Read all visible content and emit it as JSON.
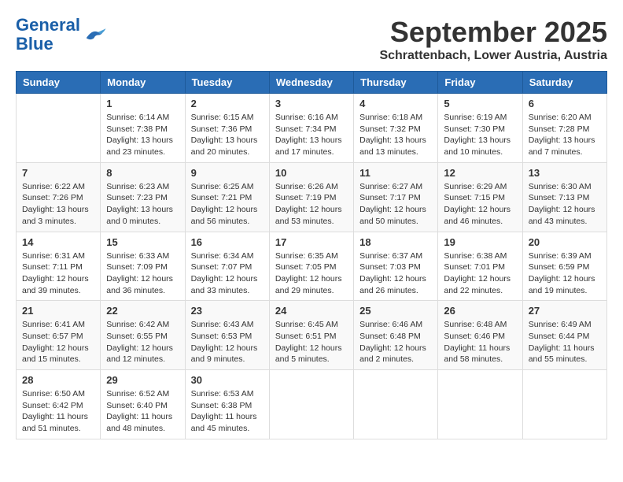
{
  "logo": {
    "line1": "General",
    "line2": "Blue"
  },
  "title": "September 2025",
  "location": "Schrattenbach, Lower Austria, Austria",
  "days_of_week": [
    "Sunday",
    "Monday",
    "Tuesday",
    "Wednesday",
    "Thursday",
    "Friday",
    "Saturday"
  ],
  "weeks": [
    [
      {
        "day": "",
        "info": ""
      },
      {
        "day": "1",
        "info": "Sunrise: 6:14 AM\nSunset: 7:38 PM\nDaylight: 13 hours\nand 23 minutes."
      },
      {
        "day": "2",
        "info": "Sunrise: 6:15 AM\nSunset: 7:36 PM\nDaylight: 13 hours\nand 20 minutes."
      },
      {
        "day": "3",
        "info": "Sunrise: 6:16 AM\nSunset: 7:34 PM\nDaylight: 13 hours\nand 17 minutes."
      },
      {
        "day": "4",
        "info": "Sunrise: 6:18 AM\nSunset: 7:32 PM\nDaylight: 13 hours\nand 13 minutes."
      },
      {
        "day": "5",
        "info": "Sunrise: 6:19 AM\nSunset: 7:30 PM\nDaylight: 13 hours\nand 10 minutes."
      },
      {
        "day": "6",
        "info": "Sunrise: 6:20 AM\nSunset: 7:28 PM\nDaylight: 13 hours\nand 7 minutes."
      }
    ],
    [
      {
        "day": "7",
        "info": "Sunrise: 6:22 AM\nSunset: 7:26 PM\nDaylight: 13 hours\nand 3 minutes."
      },
      {
        "day": "8",
        "info": "Sunrise: 6:23 AM\nSunset: 7:23 PM\nDaylight: 13 hours\nand 0 minutes."
      },
      {
        "day": "9",
        "info": "Sunrise: 6:25 AM\nSunset: 7:21 PM\nDaylight: 12 hours\nand 56 minutes."
      },
      {
        "day": "10",
        "info": "Sunrise: 6:26 AM\nSunset: 7:19 PM\nDaylight: 12 hours\nand 53 minutes."
      },
      {
        "day": "11",
        "info": "Sunrise: 6:27 AM\nSunset: 7:17 PM\nDaylight: 12 hours\nand 50 minutes."
      },
      {
        "day": "12",
        "info": "Sunrise: 6:29 AM\nSunset: 7:15 PM\nDaylight: 12 hours\nand 46 minutes."
      },
      {
        "day": "13",
        "info": "Sunrise: 6:30 AM\nSunset: 7:13 PM\nDaylight: 12 hours\nand 43 minutes."
      }
    ],
    [
      {
        "day": "14",
        "info": "Sunrise: 6:31 AM\nSunset: 7:11 PM\nDaylight: 12 hours\nand 39 minutes."
      },
      {
        "day": "15",
        "info": "Sunrise: 6:33 AM\nSunset: 7:09 PM\nDaylight: 12 hours\nand 36 minutes."
      },
      {
        "day": "16",
        "info": "Sunrise: 6:34 AM\nSunset: 7:07 PM\nDaylight: 12 hours\nand 33 minutes."
      },
      {
        "day": "17",
        "info": "Sunrise: 6:35 AM\nSunset: 7:05 PM\nDaylight: 12 hours\nand 29 minutes."
      },
      {
        "day": "18",
        "info": "Sunrise: 6:37 AM\nSunset: 7:03 PM\nDaylight: 12 hours\nand 26 minutes."
      },
      {
        "day": "19",
        "info": "Sunrise: 6:38 AM\nSunset: 7:01 PM\nDaylight: 12 hours\nand 22 minutes."
      },
      {
        "day": "20",
        "info": "Sunrise: 6:39 AM\nSunset: 6:59 PM\nDaylight: 12 hours\nand 19 minutes."
      }
    ],
    [
      {
        "day": "21",
        "info": "Sunrise: 6:41 AM\nSunset: 6:57 PM\nDaylight: 12 hours\nand 15 minutes."
      },
      {
        "day": "22",
        "info": "Sunrise: 6:42 AM\nSunset: 6:55 PM\nDaylight: 12 hours\nand 12 minutes."
      },
      {
        "day": "23",
        "info": "Sunrise: 6:43 AM\nSunset: 6:53 PM\nDaylight: 12 hours\nand 9 minutes."
      },
      {
        "day": "24",
        "info": "Sunrise: 6:45 AM\nSunset: 6:51 PM\nDaylight: 12 hours\nand 5 minutes."
      },
      {
        "day": "25",
        "info": "Sunrise: 6:46 AM\nSunset: 6:48 PM\nDaylight: 12 hours\nand 2 minutes."
      },
      {
        "day": "26",
        "info": "Sunrise: 6:48 AM\nSunset: 6:46 PM\nDaylight: 11 hours\nand 58 minutes."
      },
      {
        "day": "27",
        "info": "Sunrise: 6:49 AM\nSunset: 6:44 PM\nDaylight: 11 hours\nand 55 minutes."
      }
    ],
    [
      {
        "day": "28",
        "info": "Sunrise: 6:50 AM\nSunset: 6:42 PM\nDaylight: 11 hours\nand 51 minutes."
      },
      {
        "day": "29",
        "info": "Sunrise: 6:52 AM\nSunset: 6:40 PM\nDaylight: 11 hours\nand 48 minutes."
      },
      {
        "day": "30",
        "info": "Sunrise: 6:53 AM\nSunset: 6:38 PM\nDaylight: 11 hours\nand 45 minutes."
      },
      {
        "day": "",
        "info": ""
      },
      {
        "day": "",
        "info": ""
      },
      {
        "day": "",
        "info": ""
      },
      {
        "day": "",
        "info": ""
      }
    ]
  ]
}
